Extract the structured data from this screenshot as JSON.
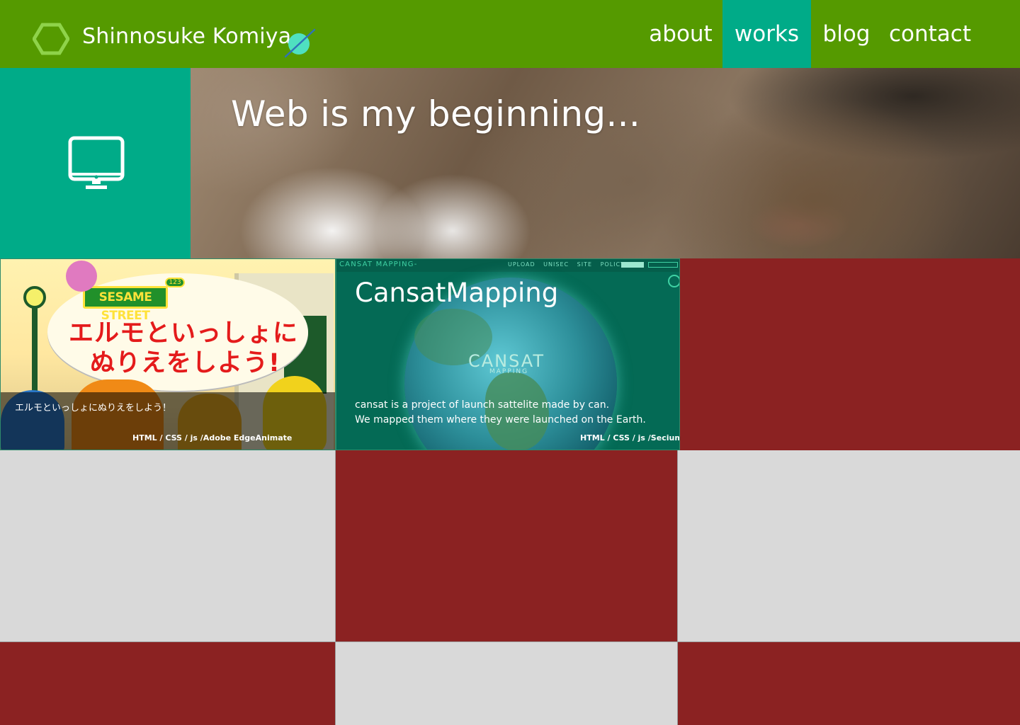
{
  "header": {
    "site_title": "Shinnosuke Komiya",
    "nav": {
      "about": "about",
      "works": "works",
      "blog": "blog",
      "contact": "contact"
    },
    "active_nav": "works"
  },
  "hero": {
    "tagline": "Web is my beginning..."
  },
  "projects": [
    {
      "image": {
        "badge_number": "123",
        "badge": "SESAME STREET",
        "heading_line1": "エルモといっしょに",
        "heading_line2": "ぬりえをしよう!"
      },
      "caption": "エルモといっしょにぬりえをしよう！",
      "tags": "HTML / CSS / js /Adobe EdgeAnimate"
    },
    {
      "image": {
        "app_title": "CANSAT MAPPING-",
        "menu_links": "UPLOAD UNISEC SITE POLICY",
        "logo": "CANSAT",
        "logo_sub": "MAPPING"
      },
      "title": "CansatMapping",
      "description_line1": "cansat is a project of launch sattelite made by can.",
      "description_line2": "We mapped them where they were launched on the Earth.",
      "tags": "HTML / CSS / js /Secium"
    }
  ],
  "colors": {
    "header_green": "#559a00",
    "accent_teal": "#00ab88",
    "tile_red": "#8b2222",
    "tile_gray": "#d9d9d9",
    "planet_teal": "#4fe0c0"
  },
  "icons": [
    "hexagon-logo-icon",
    "planet-icon",
    "monitor-icon"
  ]
}
